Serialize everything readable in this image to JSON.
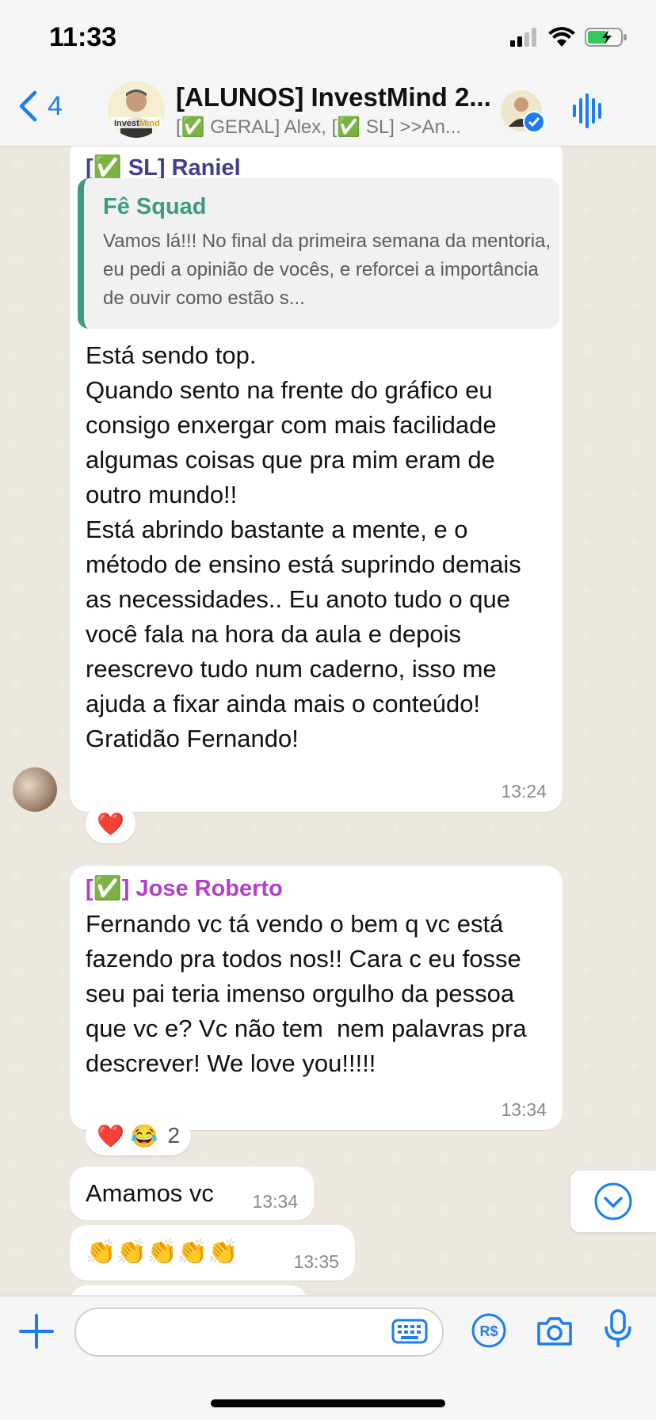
{
  "status": {
    "time": "11:33"
  },
  "header": {
    "back_count": "4",
    "title": "[ALUNOS] InvestMind 2...",
    "subtitle": "[✅ GERAL] Alex, [✅ SL] >>An..."
  },
  "messages": [
    {
      "sender": "[✅ SL] Raniel",
      "sender_color": "#3f3f8f",
      "quote_author": "Fê Squad",
      "quote_text": "Vamos lá!!! No final da primeira semana da mentoria, eu pedi a opinião de vocês, e reforcei a importância de ouvir como estão s...",
      "text": "Está sendo top.\nQuando sento na frente do gráfico eu consigo enxergar com mais facilidade algumas coisas que pra mim eram de outro mundo!!\nEstá abrindo bastante a mente, e o método de ensino está suprindo demais as necessidades.. Eu anoto tudo o que você fala na hora da aula e depois reescrevo tudo num caderno, isso me ajuda a fixar ainda mais o conteúdo!\nGratidão Fernando!",
      "time": "13:24",
      "reaction": "❤️"
    },
    {
      "sender": "[✅] Jose Roberto",
      "sender_color": "#b13fc8",
      "text": "Fernando vc tá vendo o bem q vc está fazendo pra todos nos!! Cara c eu fosse seu pai teria imenso orgulho da pessoa que vc e? Vc não tem  nem palavras pra descrever! We love you!!!!!",
      "time": "13:34",
      "reaction": "❤️ 😂",
      "reaction_count": "2"
    },
    {
      "text": "Amamos vc",
      "time": "13:34"
    },
    {
      "text": "👏👏👏👏👏",
      "time": "13:35"
    }
  ],
  "input": {
    "placeholder": ""
  },
  "colors": {
    "accent": "#1a7df0",
    "quote_bar": "#3e9a83",
    "chat_bg": "#ece7df"
  },
  "icons": [
    "chevron-left-icon",
    "audio-waveform-icon",
    "plus-icon",
    "keyboard-icon",
    "pix-icon",
    "camera-icon",
    "microphone-icon",
    "chevron-down-icon",
    "wifi-icon",
    "battery-icon",
    "signal-icon"
  ]
}
